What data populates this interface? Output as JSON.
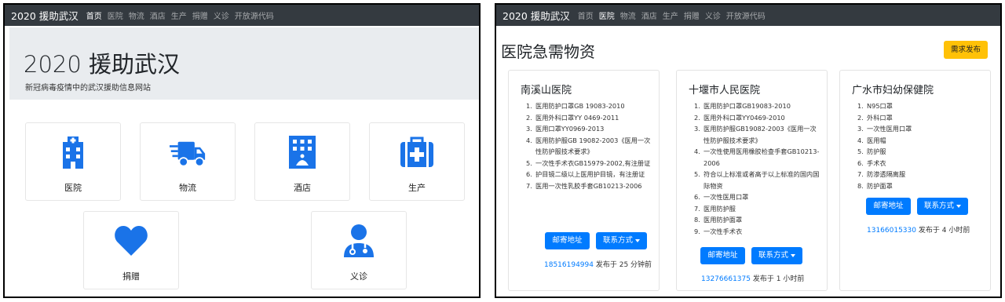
{
  "left": {
    "brand": "2020 援助武汉",
    "nav": [
      {
        "label": "首页",
        "active": true
      },
      {
        "label": "医院",
        "active": false
      },
      {
        "label": "物流",
        "active": false
      },
      {
        "label": "酒店",
        "active": false
      },
      {
        "label": "生产",
        "active": false
      },
      {
        "label": "捐赠",
        "active": false
      },
      {
        "label": "义诊",
        "active": false
      },
      {
        "label": "开放源代码",
        "active": false
      }
    ],
    "jumbotron": {
      "title": "2020 援助武汉",
      "subtitle": "新冠病毒疫情中的武汉援助信息网站"
    },
    "categories": [
      {
        "label": "医院",
        "icon": "hospital-icon"
      },
      {
        "label": "物流",
        "icon": "shipping-truck-icon"
      },
      {
        "label": "酒店",
        "icon": "hotel-icon"
      },
      {
        "label": "生产",
        "icon": "first-aid-kit-icon"
      },
      {
        "label": "捐赠",
        "icon": "heart-icon"
      },
      {
        "label": "义诊",
        "icon": "doctor-icon"
      }
    ]
  },
  "right": {
    "brand": "2020 援助武汉",
    "nav": [
      {
        "label": "首页",
        "active": false
      },
      {
        "label": "医院",
        "active": true
      },
      {
        "label": "物流",
        "active": false
      },
      {
        "label": "酒店",
        "active": false
      },
      {
        "label": "生产",
        "active": false
      },
      {
        "label": "捐赠",
        "active": false
      },
      {
        "label": "义诊",
        "active": false
      },
      {
        "label": "开放源代码",
        "active": false
      }
    ],
    "title": "医院急需物资",
    "request_button": "需求发布",
    "address_button": "邮寄地址",
    "contact_button": "联系方式",
    "hospitals": [
      {
        "name": "南溪山医院",
        "items": [
          "医用防护口罩GB 19083-2010",
          "医用外科口罩YY 0469-2011",
          "医用口罩YY0969-2013",
          "医用防护服GB 19082-2003《医用一次性防护服技术要求》",
          "一次性手术衣GB15979-2002,有注册证",
          "护目镜二级以上医用护目镜，有注册证",
          "医用一次性乳胶手套GB10213-2006"
        ],
        "phone": "18516194994",
        "posted": "发布于 25 分钟前"
      },
      {
        "name": "十堰市人民医院",
        "items": [
          "医用防护口罩GB19083-2010",
          "医用外科口罩YY0469-2010",
          "医用防护服GB19082-2003《医用一次性防护服技术要求》",
          "一次性使用医用橡胶检查手套GB10213-2006",
          "符合以上标准或者高于以上标准的国内国际物资",
          "一次性医用口罩",
          "医用防护服",
          "医用防护面罩",
          "一次性手术衣"
        ],
        "phone": "13276661375",
        "posted": "发布于 1 小时前"
      },
      {
        "name": "广水市妇幼保健院",
        "items": [
          "N95口罩",
          "外科口罩",
          "一次性医用口罩",
          "医用帽",
          "防护服",
          "手术衣",
          "防渗透隔离服",
          "防护面罩"
        ],
        "phone": "13166015330",
        "posted": "发布于 4 小时前"
      }
    ]
  }
}
